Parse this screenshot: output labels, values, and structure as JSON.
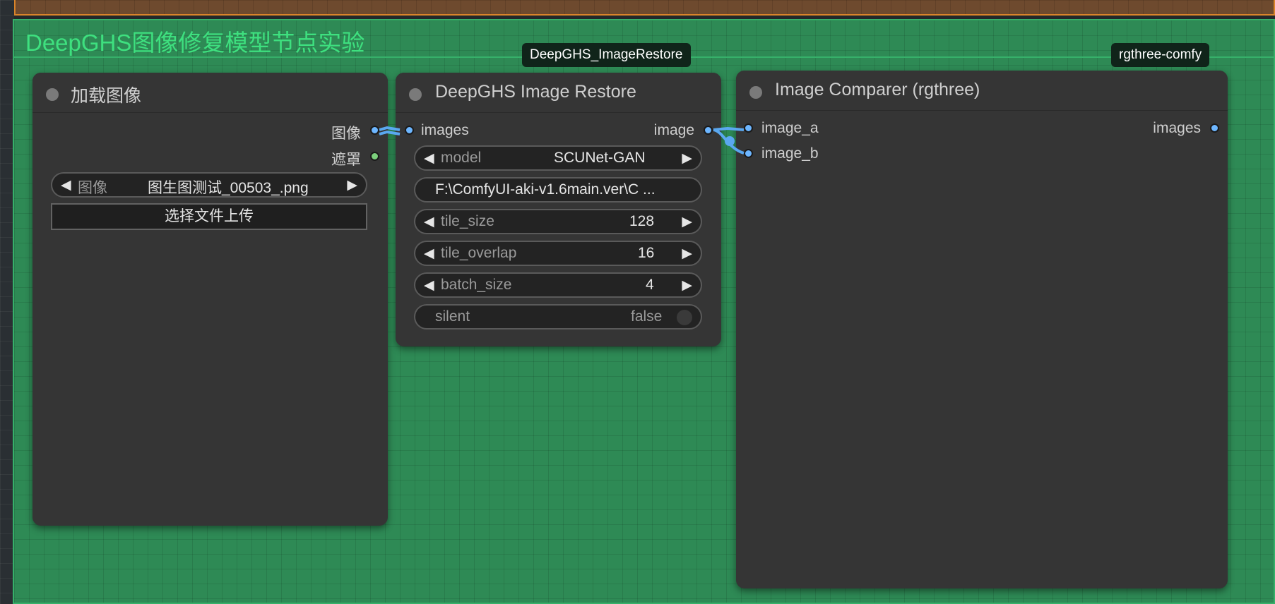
{
  "group": {
    "title": "DeepGHS图像修复模型节点实验",
    "color": "#2e8a55"
  },
  "badges": {
    "restore_pack": "DeepGHS_ImageRestore",
    "comparer_pack": "rgthree-comfy"
  },
  "load_image_node": {
    "title": "加载图像",
    "outputs": [
      "图像",
      "遮罩"
    ],
    "image_widget": {
      "name": "图像",
      "value": "图生图测试_00503_.png"
    },
    "upload_label": "选择文件上传"
  },
  "restore_node": {
    "title": "DeepGHS Image Restore",
    "input": "images",
    "output": "image",
    "model": {
      "name": "model",
      "value": "SCUNet-GAN"
    },
    "path": "F:\\ComfyUI-aki-v1.6main.ver\\C ...",
    "tile_size": {
      "name": "tile_size",
      "value": "128"
    },
    "tile_overlap": {
      "name": "tile_overlap",
      "value": "16"
    },
    "batch_size": {
      "name": "batch_size",
      "value": "4"
    },
    "silent": {
      "name": "silent",
      "value": "false"
    }
  },
  "comparer_node": {
    "title": "Image Comparer (rgthree)",
    "inputs": [
      "image_a",
      "image_b"
    ],
    "output": "images"
  },
  "colors": {
    "image_port": "#6db6ff",
    "mask_port": "#7ccf7c",
    "group_title": "#3ee07f"
  }
}
